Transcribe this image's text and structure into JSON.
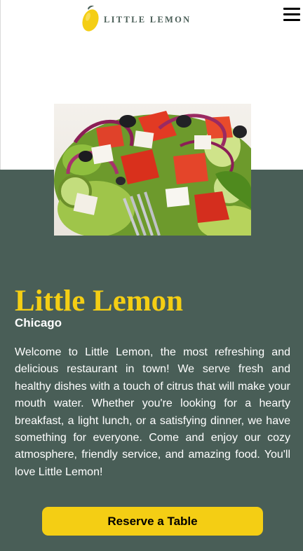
{
  "header": {
    "brand_name": "LITTLE LEMON",
    "logo_icon": "lemon-icon",
    "menu_icon": "hamburger-menu-icon"
  },
  "hero": {
    "image_subject": "greek salad with tomatoes, red onion, feta, olives and cucumber",
    "title": "Little Lemon",
    "location": "Chicago",
    "description": "Welcome to Little Lemon, the most refreshing and delicious restaurant in town! We serve fresh and healthy dishes with a touch of citrus that will make your mouth water. Whether you're looking for a hearty breakfast, a light lunch, or a satisfying dinner, we have something for everyone. Come and enjoy our cozy atmosphere, friendly service, and amazing food. You'll love Little Lemon!",
    "cta_label": "Reserve a Table"
  },
  "colors": {
    "primary_green": "#495e57",
    "primary_yellow": "#f4ce14",
    "text_light": "#ffffff"
  }
}
